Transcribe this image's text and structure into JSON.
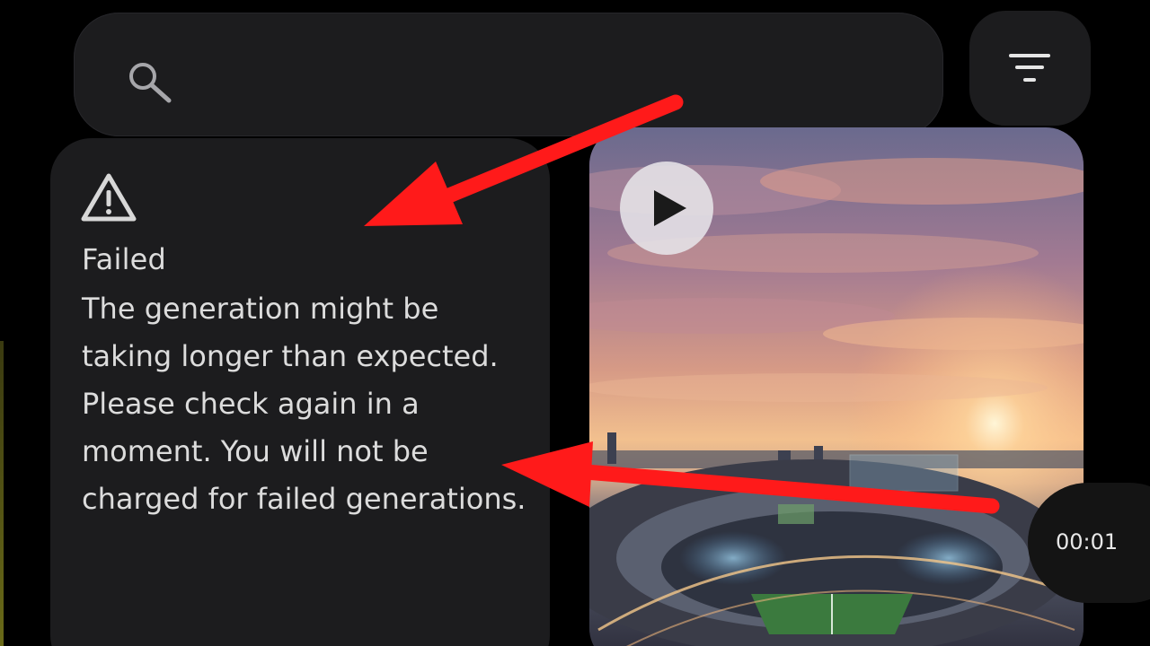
{
  "search": {
    "icon": "search-icon"
  },
  "filter": {
    "icon": "filter-icon"
  },
  "failed_card": {
    "icon": "warning-icon",
    "title": "Failed",
    "message": "The generation might be taking longer than expected. Please check again in a moment. You will not be charged for failed generations."
  },
  "video_card": {
    "play_icon": "play-icon",
    "duration": "00:01"
  },
  "colors": {
    "background": "#000000",
    "surface": "#1c1c1e",
    "text": "#dcdcdc",
    "annotation_arrow": "#ff1a1a"
  }
}
